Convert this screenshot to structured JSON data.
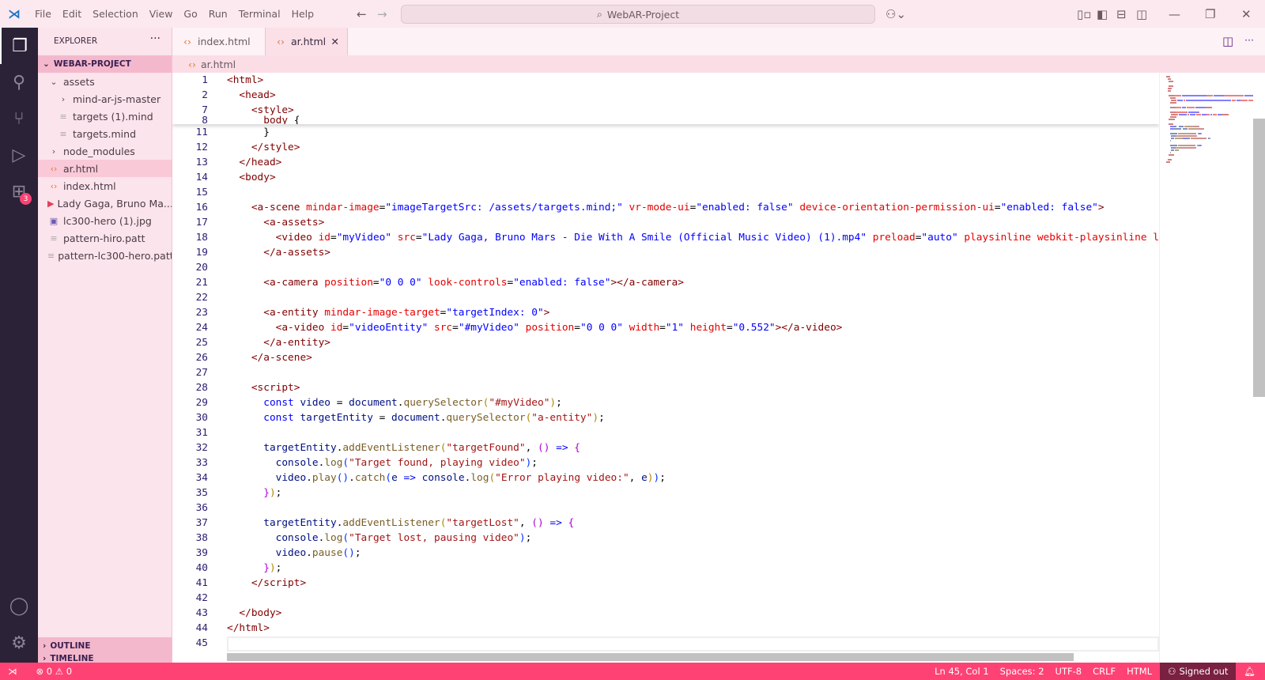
{
  "app": {
    "menu": [
      "File",
      "Edit",
      "Selection",
      "View",
      "Go",
      "Run",
      "Terminal",
      "Help"
    ],
    "search": "WebAR-Project",
    "accent": "#ff4274"
  },
  "activity": {
    "icons": [
      "files-icon",
      "search-icon",
      "source-control-icon",
      "run-debug-icon",
      "extensions-icon"
    ],
    "extensions_badge": "3"
  },
  "explorer": {
    "title": "EXPLORER",
    "project": "WEBAR-PROJECT",
    "items": [
      {
        "label": "assets",
        "type": "folder-open",
        "depth": 1
      },
      {
        "label": "mind-ar-js-master",
        "type": "folder",
        "depth": 2
      },
      {
        "label": "targets (1).mind",
        "type": "file",
        "depth": 2
      },
      {
        "label": "targets.mind",
        "type": "file",
        "depth": 2
      },
      {
        "label": "node_modules",
        "type": "folder",
        "depth": 1
      },
      {
        "label": "ar.html",
        "type": "html",
        "depth": 1,
        "selected": true
      },
      {
        "label": "index.html",
        "type": "html",
        "depth": 1
      },
      {
        "label": "Lady Gaga, Bruno Ma...",
        "type": "video",
        "depth": 1
      },
      {
        "label": "lc300-hero (1).jpg",
        "type": "image",
        "depth": 1
      },
      {
        "label": "pattern-hiro.patt",
        "type": "file",
        "depth": 1
      },
      {
        "label": "pattern-lc300-hero.patt",
        "type": "file",
        "depth": 1
      }
    ],
    "outline": "OUTLINE",
    "timeline": "TIMELINE"
  },
  "tabs": [
    {
      "label": "index.html",
      "active": false
    },
    {
      "label": "ar.html",
      "active": true
    }
  ],
  "breadcrumb": "ar.html",
  "sticky": [
    {
      "n": "1",
      "tokens": [
        [
          "t",
          "<html>"
        ]
      ]
    },
    {
      "n": "2",
      "tokens": [
        [
          "p",
          "  "
        ],
        [
          "t",
          "<head>"
        ]
      ]
    },
    {
      "n": "7",
      "tokens": [
        [
          "p",
          "    "
        ],
        [
          "t",
          "<style>"
        ]
      ]
    },
    {
      "n": "8",
      "tokens": [
        [
          "p",
          "      "
        ],
        [
          "t",
          "body"
        ],
        [
          "p",
          " {"
        ]
      ]
    }
  ],
  "lines": [
    {
      "n": "11",
      "tokens": [
        [
          "p",
          "      }"
        ]
      ]
    },
    {
      "n": "12",
      "tokens": [
        [
          "p",
          "    "
        ],
        [
          "t",
          "</style>"
        ]
      ]
    },
    {
      "n": "13",
      "tokens": [
        [
          "p",
          "  "
        ],
        [
          "t",
          "</head>"
        ]
      ]
    },
    {
      "n": "14",
      "tokens": [
        [
          "p",
          "  "
        ],
        [
          "t",
          "<body>"
        ]
      ]
    },
    {
      "n": "15",
      "tokens": []
    },
    {
      "n": "16",
      "tokens": [
        [
          "p",
          "    "
        ],
        [
          "t",
          "<a-scene "
        ],
        [
          "a",
          "mindar-image"
        ],
        [
          "p",
          "="
        ],
        [
          "s",
          "\"imageTargetSrc: /assets/targets.mind;\""
        ],
        [
          "p",
          " "
        ],
        [
          "a",
          "vr-mode-ui"
        ],
        [
          "p",
          "="
        ],
        [
          "s",
          "\"enabled: false\""
        ],
        [
          "p",
          " "
        ],
        [
          "a",
          "device-orientation-permission-ui"
        ],
        [
          "p",
          "="
        ],
        [
          "s",
          "\"enabled: false\""
        ],
        [
          "t",
          ">"
        ]
      ]
    },
    {
      "n": "17",
      "tokens": [
        [
          "p",
          "      "
        ],
        [
          "t",
          "<a-assets>"
        ]
      ]
    },
    {
      "n": "18",
      "tokens": [
        [
          "p",
          "        "
        ],
        [
          "t",
          "<video "
        ],
        [
          "a",
          "id"
        ],
        [
          "p",
          "="
        ],
        [
          "s",
          "\"myVideo\""
        ],
        [
          "p",
          " "
        ],
        [
          "a",
          "src"
        ],
        [
          "p",
          "="
        ],
        [
          "s",
          "\"Lady Gaga, Bruno Mars - Die With A Smile (Official Music Video) (1).mp4\""
        ],
        [
          "p",
          " "
        ],
        [
          "a",
          "preload"
        ],
        [
          "p",
          "="
        ],
        [
          "s",
          "\"auto\""
        ],
        [
          "p",
          " "
        ],
        [
          "a",
          "playsinline"
        ],
        [
          "p",
          " "
        ],
        [
          "a",
          "webkit-playsinline"
        ],
        [
          "p",
          " "
        ],
        [
          "a",
          "l"
        ]
      ]
    },
    {
      "n": "19",
      "tokens": [
        [
          "p",
          "      "
        ],
        [
          "t",
          "</a-assets>"
        ]
      ]
    },
    {
      "n": "20",
      "tokens": []
    },
    {
      "n": "21",
      "tokens": [
        [
          "p",
          "      "
        ],
        [
          "t",
          "<a-camera "
        ],
        [
          "a",
          "position"
        ],
        [
          "p",
          "="
        ],
        [
          "s",
          "\"0 0 0\""
        ],
        [
          "p",
          " "
        ],
        [
          "a",
          "look-controls"
        ],
        [
          "p",
          "="
        ],
        [
          "s",
          "\"enabled: false\""
        ],
        [
          "t",
          "></a-camera>"
        ]
      ]
    },
    {
      "n": "22",
      "tokens": []
    },
    {
      "n": "23",
      "tokens": [
        [
          "p",
          "      "
        ],
        [
          "t",
          "<a-entity "
        ],
        [
          "a",
          "mindar-image-target"
        ],
        [
          "p",
          "="
        ],
        [
          "s",
          "\"targetIndex: 0\""
        ],
        [
          "t",
          ">"
        ]
      ]
    },
    {
      "n": "24",
      "tokens": [
        [
          "p",
          "        "
        ],
        [
          "t",
          "<a-video "
        ],
        [
          "a",
          "id"
        ],
        [
          "p",
          "="
        ],
        [
          "s",
          "\"videoEntity\""
        ],
        [
          "p",
          " "
        ],
        [
          "a",
          "src"
        ],
        [
          "p",
          "="
        ],
        [
          "s",
          "\"#myVideo\""
        ],
        [
          "p",
          " "
        ],
        [
          "a",
          "position"
        ],
        [
          "p",
          "="
        ],
        [
          "s",
          "\"0 0 0\""
        ],
        [
          "p",
          " "
        ],
        [
          "a",
          "width"
        ],
        [
          "p",
          "="
        ],
        [
          "s",
          "\"1\""
        ],
        [
          "p",
          " "
        ],
        [
          "a",
          "height"
        ],
        [
          "p",
          "="
        ],
        [
          "s",
          "\"0.552\""
        ],
        [
          "t",
          "></a-video>"
        ]
      ]
    },
    {
      "n": "25",
      "tokens": [
        [
          "p",
          "      "
        ],
        [
          "t",
          "</a-entity>"
        ]
      ]
    },
    {
      "n": "26",
      "tokens": [
        [
          "p",
          "    "
        ],
        [
          "t",
          "</a-scene>"
        ]
      ]
    },
    {
      "n": "27",
      "tokens": []
    },
    {
      "n": "28",
      "tokens": [
        [
          "p",
          "    "
        ],
        [
          "t",
          "<script>"
        ]
      ]
    },
    {
      "n": "29",
      "tokens": [
        [
          "p",
          "      "
        ],
        [
          "k",
          "const "
        ],
        [
          "v",
          "video"
        ],
        [
          "p",
          " = "
        ],
        [
          "v",
          "document"
        ],
        [
          "p",
          "."
        ],
        [
          "f",
          "querySelector"
        ],
        [
          "b1",
          "("
        ],
        [
          "j",
          "\"#myVideo\""
        ],
        [
          "b1",
          ")"
        ],
        [
          "p",
          ";"
        ]
      ]
    },
    {
      "n": "30",
      "tokens": [
        [
          "p",
          "      "
        ],
        [
          "k",
          "const "
        ],
        [
          "v",
          "targetEntity"
        ],
        [
          "p",
          " = "
        ],
        [
          "v",
          "document"
        ],
        [
          "p",
          "."
        ],
        [
          "f",
          "querySelector"
        ],
        [
          "b1",
          "("
        ],
        [
          "j",
          "\"a-entity\""
        ],
        [
          "b1",
          ")"
        ],
        [
          "p",
          ";"
        ]
      ]
    },
    {
      "n": "31",
      "tokens": []
    },
    {
      "n": "32",
      "tokens": [
        [
          "p",
          "      "
        ],
        [
          "v",
          "targetEntity"
        ],
        [
          "p",
          "."
        ],
        [
          "f",
          "addEventListener"
        ],
        [
          "b1",
          "("
        ],
        [
          "j",
          "\"targetFound\""
        ],
        [
          "p",
          ", "
        ],
        [
          "b2",
          "()"
        ],
        [
          "k",
          " => "
        ],
        [
          "b2",
          "{"
        ]
      ]
    },
    {
      "n": "33",
      "tokens": [
        [
          "p",
          "        "
        ],
        [
          "v",
          "console"
        ],
        [
          "p",
          "."
        ],
        [
          "f",
          "log"
        ],
        [
          "b3",
          "("
        ],
        [
          "j",
          "\"Target found, playing video\""
        ],
        [
          "b3",
          ")"
        ],
        [
          "p",
          ";"
        ]
      ]
    },
    {
      "n": "34",
      "tokens": [
        [
          "p",
          "        "
        ],
        [
          "v",
          "video"
        ],
        [
          "p",
          "."
        ],
        [
          "f",
          "play"
        ],
        [
          "b3",
          "()"
        ],
        [
          "p",
          "."
        ],
        [
          "f",
          "catch"
        ],
        [
          "b3",
          "("
        ],
        [
          "v",
          "e"
        ],
        [
          "k",
          " => "
        ],
        [
          "v",
          "console"
        ],
        [
          "p",
          "."
        ],
        [
          "f",
          "log"
        ],
        [
          "b1",
          "("
        ],
        [
          "j",
          "\"Error playing video:\""
        ],
        [
          "p",
          ", "
        ],
        [
          "v",
          "e"
        ],
        [
          "b1",
          ")"
        ],
        [
          "b3",
          ")"
        ],
        [
          "p",
          ";"
        ]
      ]
    },
    {
      "n": "35",
      "tokens": [
        [
          "p",
          "      "
        ],
        [
          "b2",
          "}"
        ],
        [
          "b1",
          ")"
        ],
        [
          "p",
          ";"
        ]
      ]
    },
    {
      "n": "36",
      "tokens": []
    },
    {
      "n": "37",
      "tokens": [
        [
          "p",
          "      "
        ],
        [
          "v",
          "targetEntity"
        ],
        [
          "p",
          "."
        ],
        [
          "f",
          "addEventListener"
        ],
        [
          "b1",
          "("
        ],
        [
          "j",
          "\"targetLost\""
        ],
        [
          "p",
          ", "
        ],
        [
          "b2",
          "()"
        ],
        [
          "k",
          " => "
        ],
        [
          "b2",
          "{"
        ]
      ]
    },
    {
      "n": "38",
      "tokens": [
        [
          "p",
          "        "
        ],
        [
          "v",
          "console"
        ],
        [
          "p",
          "."
        ],
        [
          "f",
          "log"
        ],
        [
          "b3",
          "("
        ],
        [
          "j",
          "\"Target lost, pausing video\""
        ],
        [
          "b3",
          ")"
        ],
        [
          "p",
          ";"
        ]
      ]
    },
    {
      "n": "39",
      "tokens": [
        [
          "p",
          "        "
        ],
        [
          "v",
          "video"
        ],
        [
          "p",
          "."
        ],
        [
          "f",
          "pause"
        ],
        [
          "b3",
          "()"
        ],
        [
          "p",
          ";"
        ]
      ]
    },
    {
      "n": "40",
      "tokens": [
        [
          "p",
          "      "
        ],
        [
          "b2",
          "}"
        ],
        [
          "b1",
          ")"
        ],
        [
          "p",
          ";"
        ]
      ]
    },
    {
      "n": "41",
      "tokens": [
        [
          "p",
          "    "
        ],
        [
          "t",
          "</script>"
        ]
      ]
    },
    {
      "n": "42",
      "tokens": []
    },
    {
      "n": "43",
      "tokens": [
        [
          "p",
          "  "
        ],
        [
          "t",
          "</body>"
        ]
      ]
    },
    {
      "n": "44",
      "tokens": [
        [
          "t",
          "</html>"
        ]
      ]
    },
    {
      "n": "45",
      "tokens": []
    }
  ],
  "status": {
    "errors": "0",
    "warnings": "0",
    "position": "Ln 45, Col 1",
    "spaces": "Spaces: 2",
    "encoding": "UTF-8",
    "eol": "CRLF",
    "language": "HTML",
    "account": "Signed out"
  }
}
